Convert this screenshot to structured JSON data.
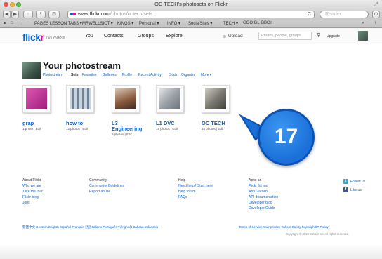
{
  "window": {
    "title": "OC TECH's photosets on Flickr",
    "resize_icon": "⤢"
  },
  "toolbar": {
    "back": "◀",
    "forward": "▶",
    "home": "⌂",
    "share": "⇪",
    "reader_btn": "⊡",
    "url_host": "www.flickr.com",
    "url_path": "/photos/octech/sets",
    "reload": "C",
    "reader_label": "Reader",
    "downloads": "⊙"
  },
  "bookmarks": {
    "items": [
      "⚭",
      "□",
      "∷",
      "PAGES LESSON TABS ▾",
      "MRWELLSICT ▾",
      "KINGS ▾",
      "Personal ▾",
      "INFO ▾",
      "SocialSites ▾",
      "TECH ▾",
      "GOO.GL",
      "BBCn",
      "»",
      "+"
    ]
  },
  "header": {
    "logo_a": "flick",
    "logo_b": "r",
    "logo_sub": "from YAHOO!",
    "nav": [
      "You",
      "Contacts",
      "Groups",
      "Explore"
    ],
    "upload": "Upload",
    "search_placeholder": "Photos, people, groups",
    "upgrade": "Upgrade"
  },
  "photostream": {
    "title": "Your photostream",
    "subnav": [
      "Photostream",
      "Sets",
      "Favorites",
      "Galleries",
      "Profile",
      "Recent Activity",
      "Stats",
      "Organize",
      "More ▾"
    ],
    "active_tab": "Sets"
  },
  "sets": [
    {
      "title": "grap",
      "meta": "1 photo | Edit",
      "color": "#c9309a"
    },
    {
      "title": "how to",
      "meta": "12 photos | Edit",
      "color": "#7d8ea3"
    },
    {
      "title": "L3",
      "title2": "Engineering",
      "meta": "8 photos | Edit",
      "color": "#a06a52"
    },
    {
      "title": "L1 DVC",
      "meta": "15 photos | Edit",
      "color": "#9ca0a6"
    },
    {
      "title": "OC TECH",
      "meta": "34 photos | Edit",
      "color": "#6b6d66"
    }
  ],
  "badge": {
    "number": "17"
  },
  "footer": {
    "cols": [
      {
        "head": "About Flickr",
        "links": [
          "Who we are",
          "Take the tour",
          "Flickr blog",
          "Jobs"
        ]
      },
      {
        "head": "Community",
        "links": [
          "Community Guidelines",
          "Report abuse"
        ]
      },
      {
        "head": "Help",
        "links": [
          "Need help? Start here!",
          "Help forum",
          "FAQs"
        ]
      },
      {
        "head": "Apps an",
        "links": [
          "Flickr for mo",
          "App Garden",
          "API documentation",
          "Developer blog",
          "Developer Guide"
        ]
      }
    ],
    "social": [
      "Follow us",
      "Like us"
    ],
    "languages": "繁體中文  Deutsch  English  Español  Français  한글  Italiano  Português  Tiếng Việt  Bahasa Indonesia",
    "legal": "Terms of Service  Your privacy  Yahoo! Safety  Copyright/IP Policy",
    "copyright": "Copyright © 2013 Yahoo! Inc. All rights reserved."
  }
}
